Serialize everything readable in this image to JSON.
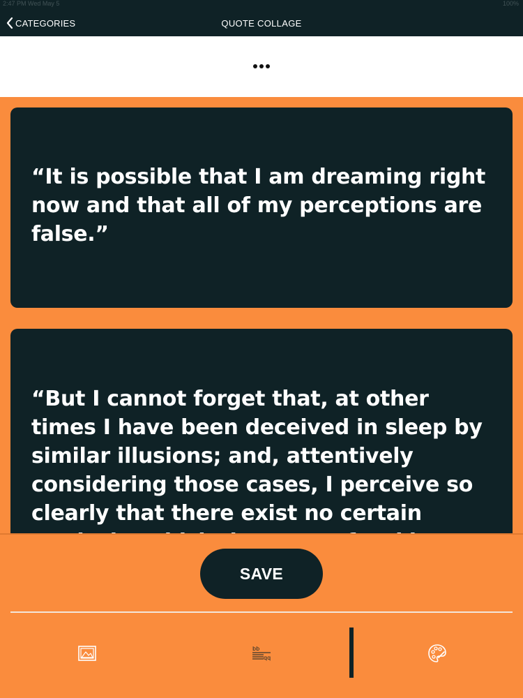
{
  "status_bar": {
    "left": "2:47 PM   Wed May 5",
    "right": "100%"
  },
  "nav": {
    "back_label": "CATEGORIES",
    "title": "QUOTE COLLAGE"
  },
  "quotes": [
    "“It is possible that I am dreaming right now and that all of my perceptions are false.”",
    "“But I cannot forget that, at other times I have been deceived in sleep by similar illusions; and, attentively considering those cases, I perceive so clearly that there exist no certain marks by which the state of waking can be distinguished from sleep.”"
  ],
  "actions": {
    "save_label": "SAVE"
  },
  "toolbar": {
    "icons": [
      "image-icon",
      "text-style-icon",
      "palette-icon"
    ]
  },
  "colors": {
    "background": "#FA8C3D",
    "card": "#0F2226",
    "text": "#FFFFFF",
    "nav": "#0F2226"
  }
}
